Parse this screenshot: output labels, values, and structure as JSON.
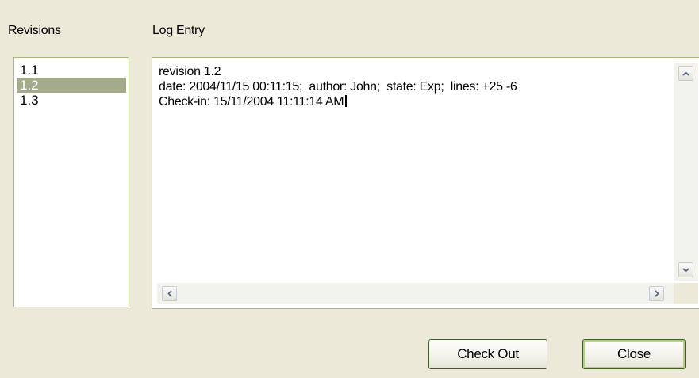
{
  "revisions": {
    "label": "Revisions",
    "items": [
      {
        "label": "1.1",
        "selected": false
      },
      {
        "label": "1.2",
        "selected": true
      },
      {
        "label": "1.3",
        "selected": false
      }
    ]
  },
  "log": {
    "label": "Log Entry",
    "lines": [
      "revision 1.2",
      "date: 2004/11/15 00:11:15;  author: John;  state: Exp;  lines: +25 -6",
      "Check-in: 15/11/2004 11:11:14 AM"
    ]
  },
  "scroll_icons": {
    "up": "chevron-up-icon",
    "down": "chevron-down-icon",
    "left": "chevron-left-icon",
    "right": "chevron-right-icon"
  },
  "buttons": {
    "check_out": "Check Out",
    "close": "Close"
  },
  "colors": {
    "window_bg": "#ece9d8",
    "selection": "#a3ab8c",
    "border": "#a5b97a",
    "default_button_highlight": "#b3cf86"
  }
}
